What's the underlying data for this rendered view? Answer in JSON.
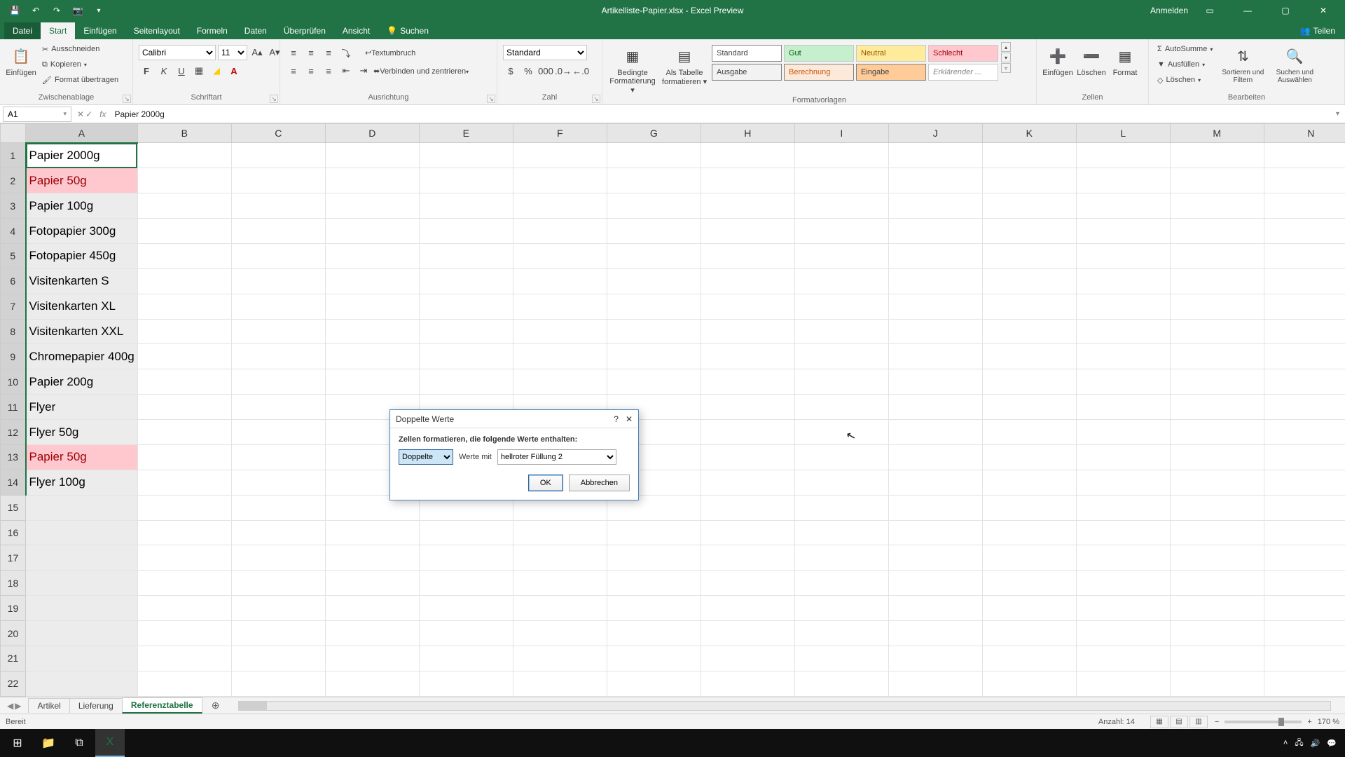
{
  "titlebar": {
    "doc_title": "Artikelliste-Papier.xlsx - Excel Preview",
    "signin": "Anmelden"
  },
  "tabs": {
    "file": "Datei",
    "home": "Start",
    "insert": "Einfügen",
    "layout": "Seitenlayout",
    "formulas": "Formeln",
    "data": "Daten",
    "review": "Überprüfen",
    "view": "Ansicht",
    "search": "Suchen",
    "share": "Teilen"
  },
  "ribbon": {
    "clipboard": {
      "paste": "Einfügen",
      "cut": "Ausschneiden",
      "copy": "Kopieren",
      "formatpainter": "Format übertragen",
      "label": "Zwischenablage"
    },
    "font": {
      "name": "Calibri",
      "size": "11",
      "label": "Schriftart"
    },
    "align": {
      "wrap": "Textumbruch",
      "merge": "Verbinden und zentrieren",
      "label": "Ausrichtung"
    },
    "number": {
      "format": "Standard",
      "label": "Zahl"
    },
    "condfmt": {
      "line1": "Bedingte",
      "line2": "Formatierung"
    },
    "astable": {
      "line1": "Als Tabelle",
      "line2": "formatieren"
    },
    "styles": {
      "standard": "Standard",
      "gut": "Gut",
      "neutral": "Neutral",
      "schlecht": "Schlecht",
      "ausgabe": "Ausgabe",
      "berechnung": "Berechnung",
      "eingabe": "Eingabe",
      "erkl": "Erklärender ...",
      "label": "Formatvorlagen"
    },
    "cells": {
      "insert": "Einfügen",
      "delete": "Löschen",
      "format": "Format",
      "label": "Zellen"
    },
    "editing": {
      "autosum": "AutoSumme",
      "fill": "Ausfüllen",
      "clear": "Löschen",
      "sort": "Sortieren und Filtern",
      "find": "Suchen und Auswählen",
      "label": "Bearbeiten"
    }
  },
  "namebox": {
    "ref": "A1"
  },
  "formula": {
    "value": "Papier 2000g"
  },
  "columns": [
    "A",
    "B",
    "C",
    "D",
    "E",
    "F",
    "G",
    "H",
    "I",
    "J",
    "K",
    "L",
    "M",
    "N"
  ],
  "rows": [
    {
      "n": 1,
      "a": "Papier 2000g",
      "dup": false,
      "active": true
    },
    {
      "n": 2,
      "a": "Papier 50g",
      "dup": true
    },
    {
      "n": 3,
      "a": "Papier 100g",
      "dup": false
    },
    {
      "n": 4,
      "a": "Fotopapier 300g",
      "dup": false
    },
    {
      "n": 5,
      "a": "Fotopapier 450g",
      "dup": false
    },
    {
      "n": 6,
      "a": "Visitenkarten S",
      "dup": false
    },
    {
      "n": 7,
      "a": "Visitenkarten XL",
      "dup": false
    },
    {
      "n": 8,
      "a": "Visitenkarten XXL",
      "dup": false
    },
    {
      "n": 9,
      "a": "Chromepapier 400g",
      "dup": false
    },
    {
      "n": 10,
      "a": "Papier 200g",
      "dup": false
    },
    {
      "n": 11,
      "a": "Flyer",
      "dup": false
    },
    {
      "n": 12,
      "a": "Flyer 50g",
      "dup": false
    },
    {
      "n": 13,
      "a": "Papier 50g",
      "dup": true
    },
    {
      "n": 14,
      "a": "Flyer 100g",
      "dup": false
    },
    {
      "n": 15,
      "a": "",
      "dup": false
    },
    {
      "n": 16,
      "a": "",
      "dup": false
    },
    {
      "n": 17,
      "a": "",
      "dup": false
    },
    {
      "n": 18,
      "a": "",
      "dup": false
    },
    {
      "n": 19,
      "a": "",
      "dup": false
    },
    {
      "n": 20,
      "a": "",
      "dup": false
    },
    {
      "n": 21,
      "a": "",
      "dup": false
    },
    {
      "n": 22,
      "a": "",
      "dup": false
    }
  ],
  "sheets": {
    "s1": "Artikel",
    "s2": "Lieferung",
    "s3": "Referenztabelle"
  },
  "status": {
    "ready": "Bereit",
    "count_label": "Anzahl:",
    "count_value": "14",
    "zoom": "170 %"
  },
  "dialog": {
    "title": "Doppelte Werte",
    "instruction": "Zellen formatieren, die folgende Werte enthalten:",
    "option": "Doppelte",
    "withlabel": "Werte mit",
    "format": "hellroter Füllung 2",
    "ok": "OK",
    "cancel": "Abbrechen"
  },
  "taskbar": {
    "time": "",
    "date": ""
  }
}
